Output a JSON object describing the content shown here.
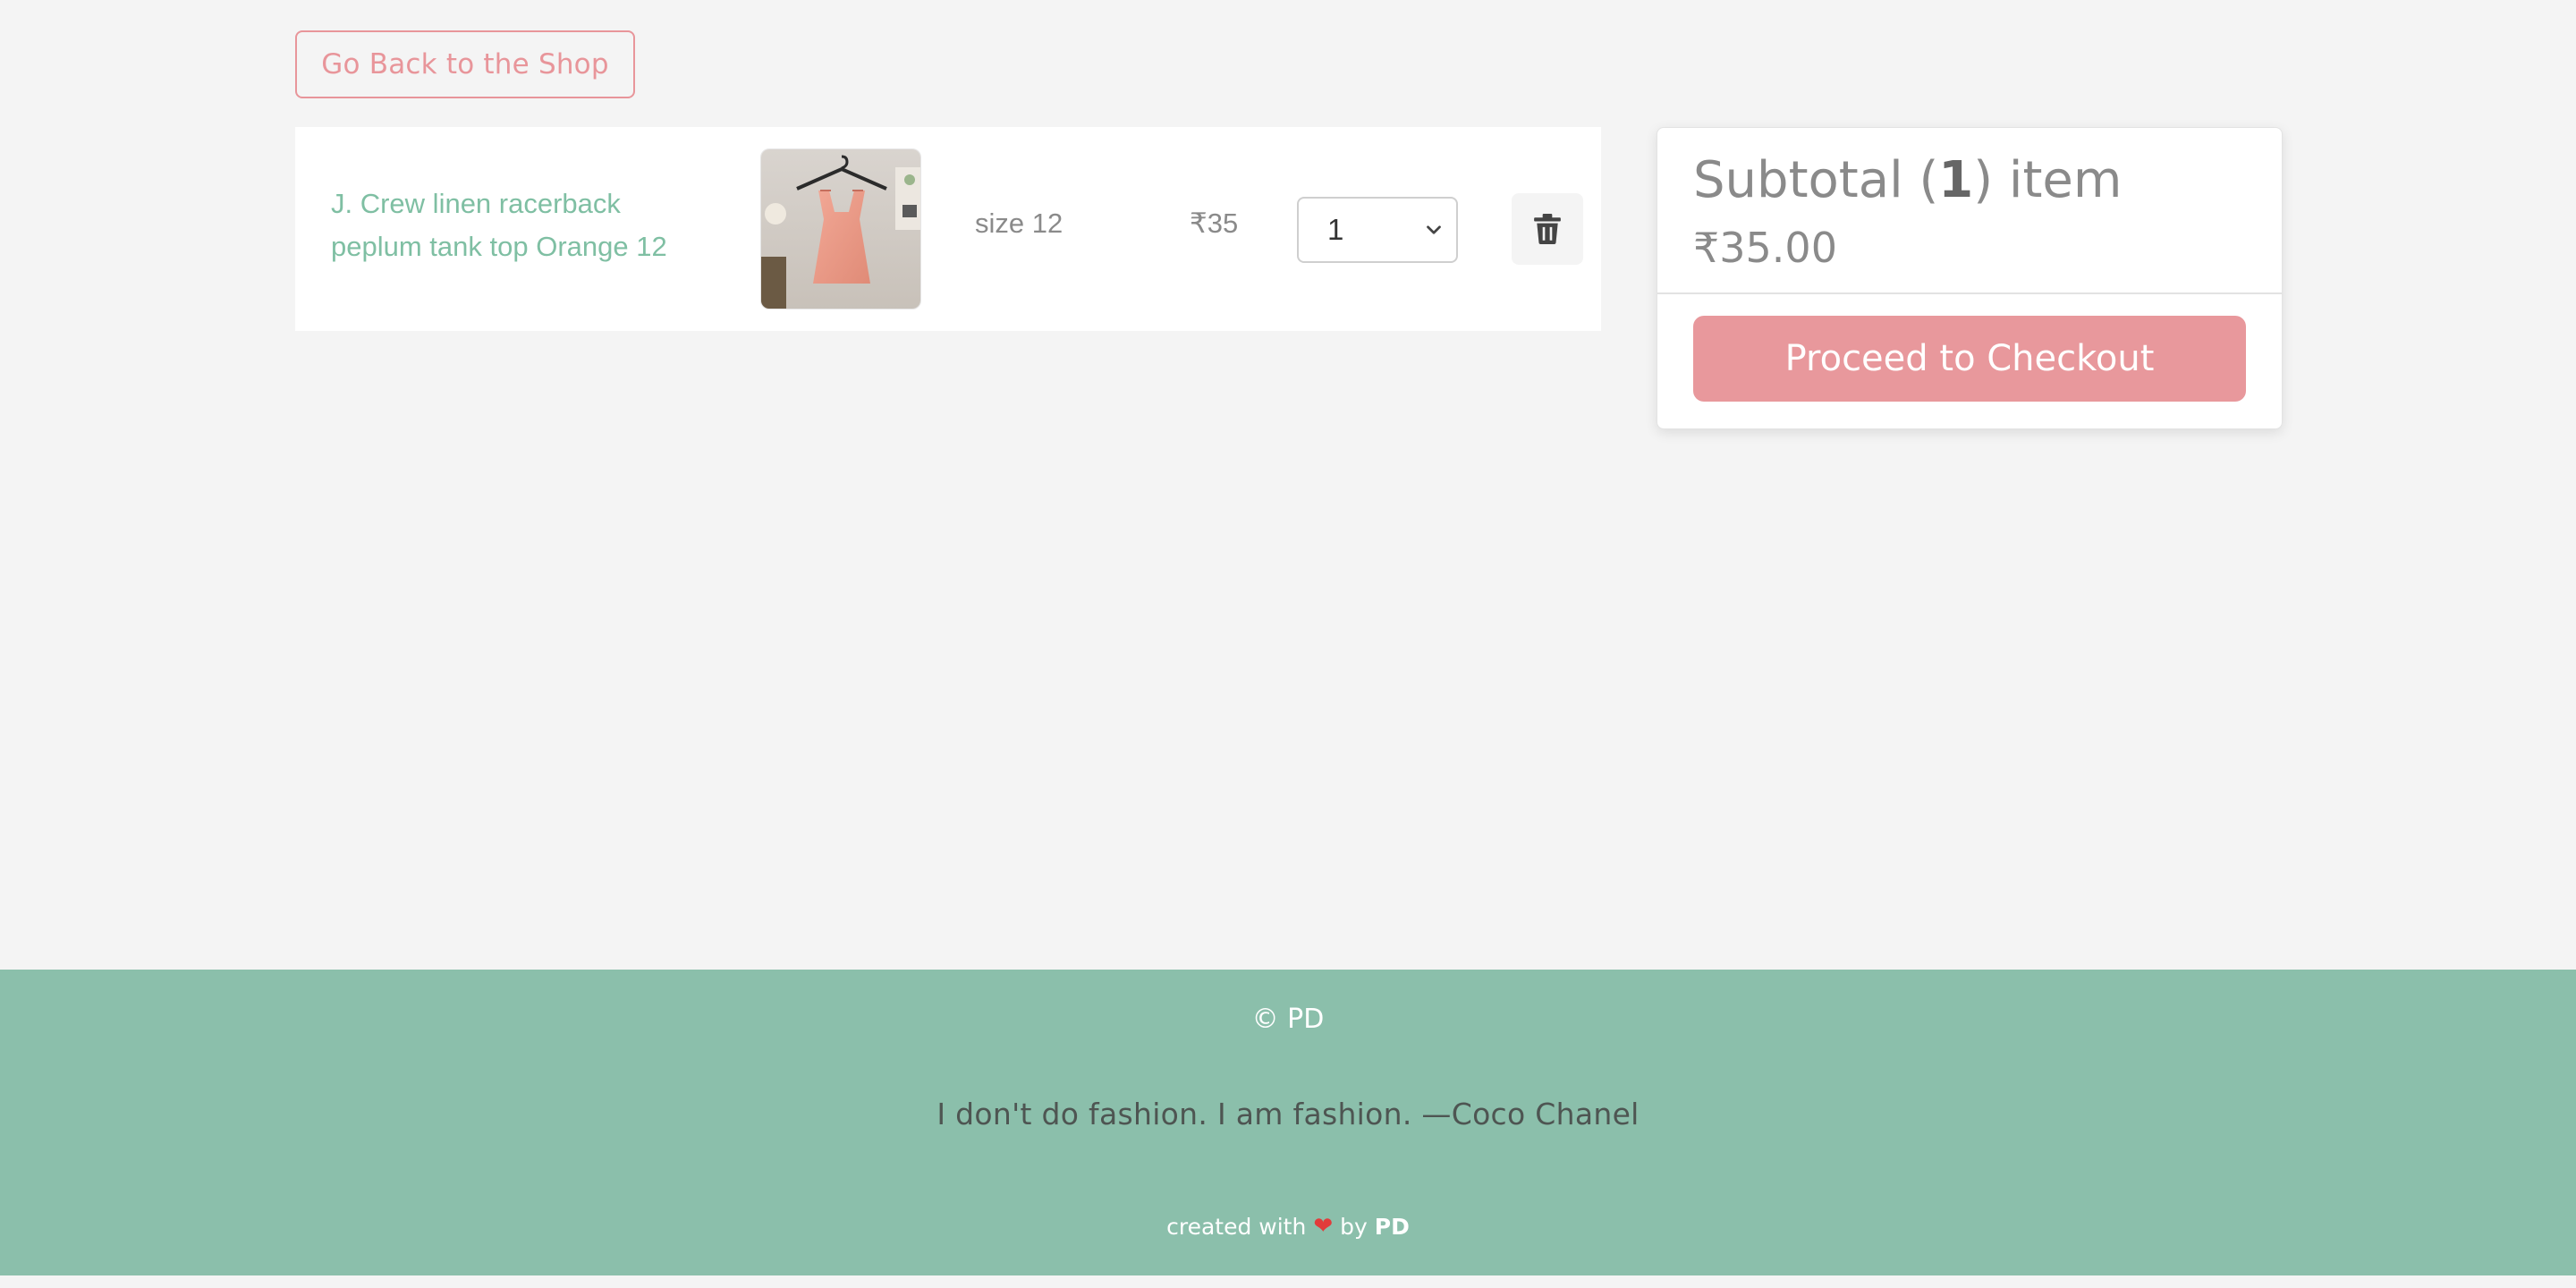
{
  "navigation": {
    "back_label": "Go Back to the Shop"
  },
  "cart": {
    "items": [
      {
        "name": "J. Crew linen racerback peplum tank top Orange 12",
        "size": "size 12",
        "price": "₹35",
        "quantity": "1",
        "image_icon": "orange-tank-top-photo"
      }
    ]
  },
  "summary": {
    "title_prefix": "Subtotal (",
    "count": "1",
    "title_suffix": ") item",
    "total": "₹35.00",
    "checkout_label": "Proceed to Checkout"
  },
  "footer": {
    "copyright": "© PD",
    "quote": "I don't do fashion. I am fashion. —Coco Chanel",
    "credit_prefix": "created with",
    "credit_by": "by",
    "credit_author": "PD",
    "heart_icon": "heart-icon"
  },
  "colors": {
    "accent_pink": "#e8959a",
    "accent_green": "#8bbfab",
    "link_green": "#7fbfa3"
  }
}
